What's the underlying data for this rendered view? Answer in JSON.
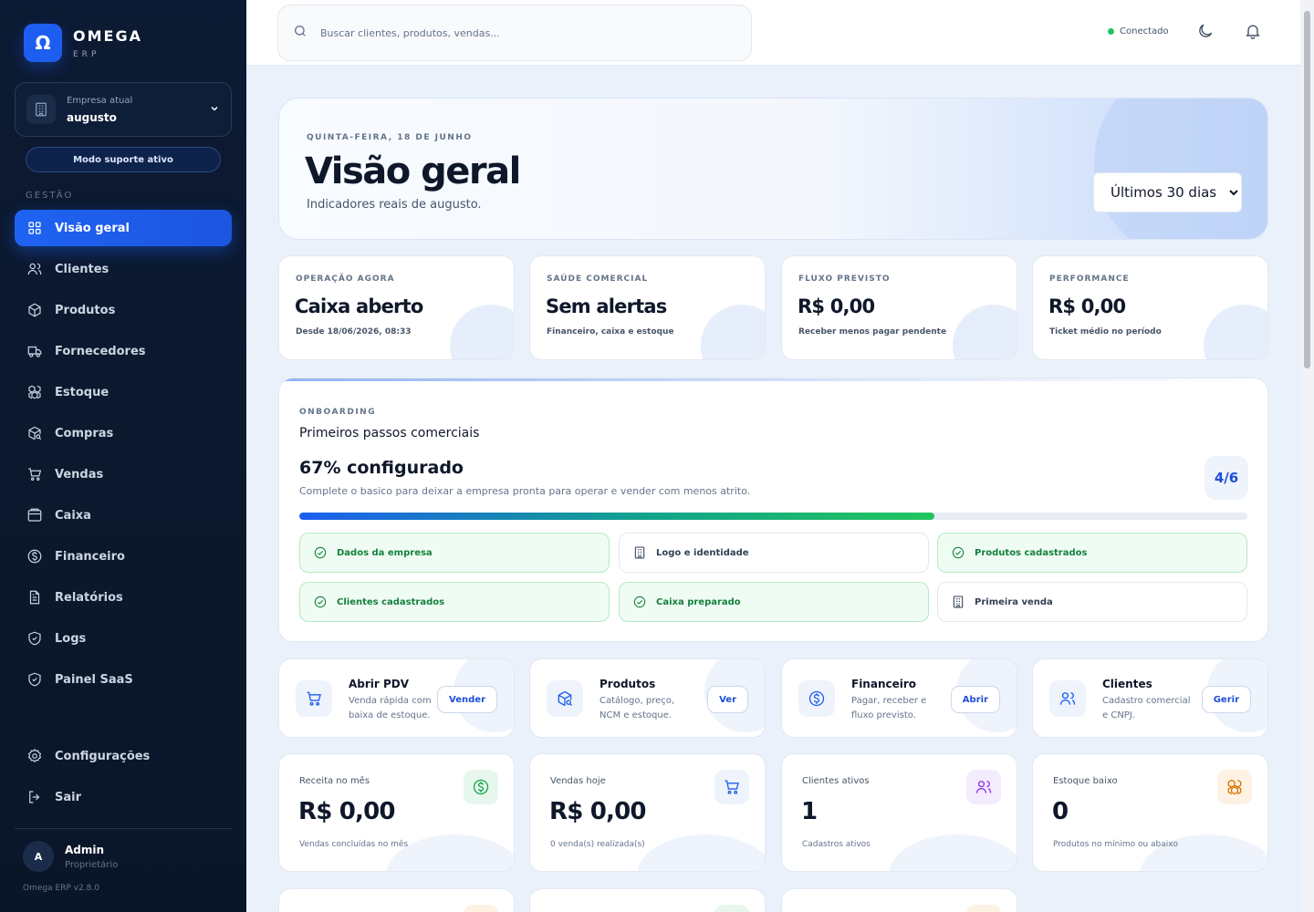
{
  "brand": {
    "logo_glyph": "Ω",
    "name": "OMEGA",
    "sub": "ERP"
  },
  "company": {
    "label": "Empresa atual",
    "value": "augusto"
  },
  "support_mode": "Modo suporte ativo",
  "nav_section": "GESTÃO",
  "nav": [
    {
      "label": "Visão geral",
      "icon": "grid-icon",
      "active": true
    },
    {
      "label": "Clientes",
      "icon": "users-icon"
    },
    {
      "label": "Produtos",
      "icon": "package-icon"
    },
    {
      "label": "Fornecedores",
      "icon": "truck-icon"
    },
    {
      "label": "Estoque",
      "icon": "boxes-icon"
    },
    {
      "label": "Compras",
      "icon": "package-search-icon"
    },
    {
      "label": "Vendas",
      "icon": "cart-icon"
    },
    {
      "label": "Caixa",
      "icon": "wallet-icon"
    },
    {
      "label": "Financeiro",
      "icon": "dollar-circle-icon"
    },
    {
      "label": "Relatórios",
      "icon": "report-icon"
    },
    {
      "label": "Logs",
      "icon": "shield-icon"
    },
    {
      "label": "Painel SaaS",
      "icon": "shield-check-icon"
    }
  ],
  "bottom_nav": [
    {
      "label": "Configurações",
      "icon": "settings-icon"
    },
    {
      "label": "Sair",
      "icon": "logout-icon"
    }
  ],
  "user": {
    "initial": "A",
    "name": "Admin",
    "role": "Proprietário"
  },
  "version": "Omega ERP v2.8.0",
  "topbar": {
    "search_placeholder": "Buscar clientes, produtos, vendas...",
    "status": "Conectado",
    "status_color": "#22c55e"
  },
  "hero": {
    "date": "QUINTA-FEIRA, 18 DE JUNHO",
    "title": "Visão geral",
    "subtitle": "Indicadores reais de augusto.",
    "period_selected": "Últimos 30 dias"
  },
  "kpis": [
    {
      "label": "OPERAÇÃO AGORA",
      "value": "Caixa aberto",
      "note": "Desde 18/06/2026, 08:33"
    },
    {
      "label": "SAÚDE COMERCIAL",
      "value": "Sem alertas",
      "note": "Financeiro, caixa e estoque"
    },
    {
      "label": "FLUXO PREVISTO",
      "value": "R$ 0,00",
      "note": "Receber menos pagar pendente"
    },
    {
      "label": "PERFORMANCE",
      "value": "R$ 0,00",
      "note": "Ticket médio no período"
    }
  ],
  "onboarding": {
    "label": "ONBOARDING",
    "title": "Primeiros passos comerciais",
    "percent_text": "67% configurado",
    "progress": 0.67,
    "description": "Complete o basico para deixar a empresa pronta para operar e vender com menos atrito.",
    "count": "4/6",
    "steps": [
      {
        "label": "Dados da empresa",
        "done": true
      },
      {
        "label": "Logo e identidade",
        "done": false
      },
      {
        "label": "Produtos cadastrados",
        "done": true
      },
      {
        "label": "Clientes cadastrados",
        "done": true
      },
      {
        "label": "Caixa preparado",
        "done": true
      },
      {
        "label": "Primeira venda",
        "done": false
      }
    ]
  },
  "shortcuts": [
    {
      "title": "Abrir PDV",
      "desc": "Venda rápida com baixa de estoque.",
      "button": "Vender",
      "icon": "cart-icon"
    },
    {
      "title": "Produtos",
      "desc": "Catálogo, preço, NCM e estoque.",
      "button": "Ver",
      "icon": "package-search-icon"
    },
    {
      "title": "Financeiro",
      "desc": "Pagar, receber e fluxo previsto.",
      "button": "Abrir",
      "icon": "dollar-circle-icon"
    },
    {
      "title": "Clientes",
      "desc": "Cadastro comercial e CNPJ.",
      "button": "Gerir",
      "icon": "users-icon"
    }
  ],
  "metrics": [
    {
      "label": "Receita no mês",
      "value": "R$ 0,00",
      "note": "Vendas concluídas no mês",
      "icon": "dollar-circle-icon",
      "icon_bg": "#e7f7ee",
      "icon_color": "#16a34a"
    },
    {
      "label": "Vendas hoje",
      "value": "R$ 0,00",
      "note": "0 venda(s) realizada(s)",
      "icon": "cart-icon",
      "icon_bg": "#eef3fc",
      "icon_color": "#1d5ef0"
    },
    {
      "label": "Clientes ativos",
      "value": "1",
      "note": "Cadastros ativos",
      "icon": "users-icon",
      "icon_bg": "#f3ecfd",
      "icon_color": "#9333ea"
    },
    {
      "label": "Estoque baixo",
      "value": "0",
      "note": "Produtos no mínimo ou abaixo",
      "icon": "boxes-icon",
      "icon_bg": "#fdf2e3",
      "icon_color": "#d97706"
    }
  ],
  "partial_cards": [
    {
      "icon_bg": "#fdf2e3"
    },
    {
      "icon_bg": "#e7f7ee"
    },
    {
      "icon_bg": "#fdf2e3"
    }
  ]
}
